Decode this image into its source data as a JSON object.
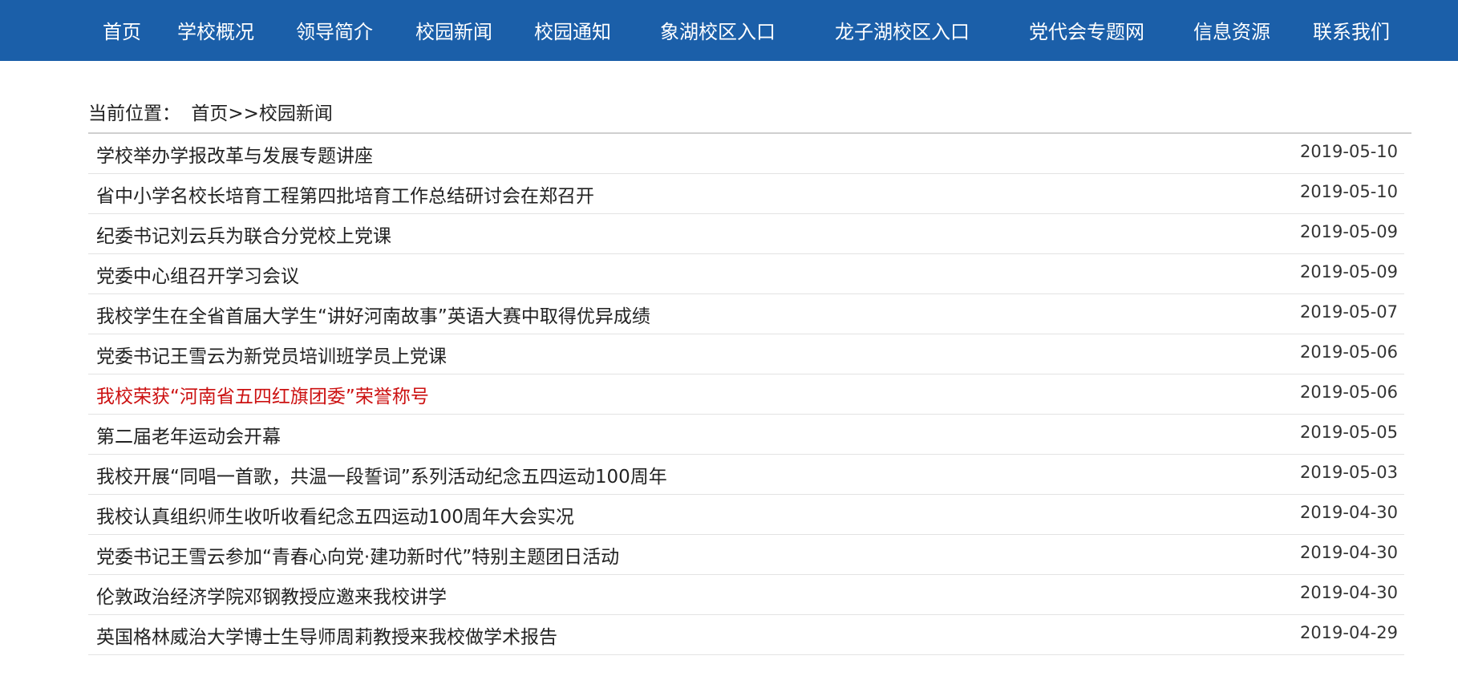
{
  "nav": {
    "items": [
      {
        "label": "首页"
      },
      {
        "label": "学校概况"
      },
      {
        "label": "领导简介"
      },
      {
        "label": "校园新闻"
      },
      {
        "label": "校园通知"
      },
      {
        "label": "象湖校区入口"
      },
      {
        "label": "龙子湖校区入口"
      },
      {
        "label": "党代会专题网"
      },
      {
        "label": "信息资源"
      },
      {
        "label": "联系我们"
      }
    ]
  },
  "breadcrumb": {
    "prefix": "当前位置：",
    "home": "首页",
    "separator": ">>",
    "current": "校园新闻"
  },
  "news": {
    "highlight_color": "#cc1111",
    "items": [
      {
        "title": "学校举办学报改革与发展专题讲座",
        "date": "2019-05-10"
      },
      {
        "title": "省中小学名校长培育工程第四批培育工作总结研讨会在郑召开",
        "date": "2019-05-10"
      },
      {
        "title": "纪委书记刘云兵为联合分党校上党课",
        "date": "2019-05-09"
      },
      {
        "title": "党委中心组召开学习会议",
        "date": "2019-05-09"
      },
      {
        "title": "我校学生在全省首届大学生“讲好河南故事”英语大赛中取得优异成绩",
        "date": "2019-05-07"
      },
      {
        "title": "党委书记王雪云为新党员培训班学员上党课",
        "date": "2019-05-06"
      },
      {
        "title": "我校荣获“河南省五四红旗团委”荣誉称号",
        "date": "2019-05-06",
        "highlight": true
      },
      {
        "title": "第二届老年运动会开幕",
        "date": "2019-05-05"
      },
      {
        "title": "我校开展“同唱一首歌，共温一段誓词”系列活动纪念五四运动100周年",
        "date": "2019-05-03"
      },
      {
        "title": "我校认真组织师生收听收看纪念五四运动100周年大会实况",
        "date": "2019-04-30"
      },
      {
        "title": "党委书记王雪云参加“青春心向党·建功新时代”特别主题团日活动",
        "date": "2019-04-30"
      },
      {
        "title": "伦敦政治经济学院邓钢教授应邀来我校讲学",
        "date": "2019-04-30"
      },
      {
        "title": "英国格林威治大学博士生导师周莉教授来我校做学术报告",
        "date": "2019-04-29"
      }
    ]
  }
}
